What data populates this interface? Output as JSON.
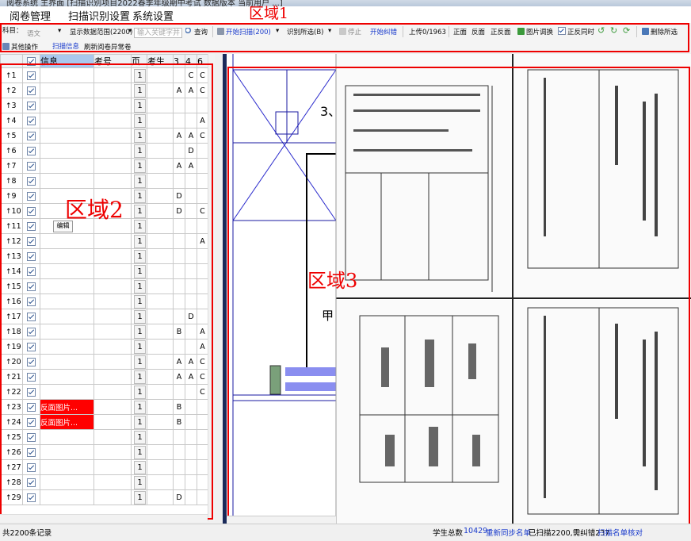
{
  "titlebar": {
    "text": "阅卷系统  主界面  [扫描识别项目2022春季年级期中考试 数据版本 当前用户 ...]"
  },
  "menu": [
    "阅卷管理",
    "扫描识别设置",
    "系统设置"
  ],
  "regions": {
    "area1": "区域1",
    "area2": "区域2",
    "area3": "区域3"
  },
  "toolbar": {
    "subject_label": "科目：",
    "subject_value": "语文",
    "range_label": "显示数据范围(2200)",
    "search_placeholder": "输入关键字并",
    "query_label": "查询",
    "start_scan_label": "开始扫描(200)",
    "recognize_label": "识别所选(B)",
    "stop_label": "停止",
    "start_correct_label": "开始纠错",
    "upload_label": "上传0/1963",
    "front_label": "正面",
    "back_label": "反面",
    "front_back_label": "正反面",
    "image_swap_label": "图片调换",
    "front_back_same_label": "正反同时",
    "delete_selected_label": "删除所选",
    "other_ops_label": "其他操作",
    "scan_info_label": "扫描信息",
    "refresh_label": "刷新阅卷异常卷"
  },
  "grid": {
    "headers": [
      "信息",
      "考号",
      "页",
      "考生",
      "3",
      "4",
      "6"
    ],
    "page_value": "1",
    "rows": [
      {
        "n": "1",
        "info": "",
        "c3": "",
        "c4": "C",
        "c6": "C"
      },
      {
        "n": "2",
        "info": "",
        "c3": "A",
        "c4": "A",
        "c6": "C"
      },
      {
        "n": "3",
        "info": "",
        "c3": "",
        "c4": "",
        "c6": ""
      },
      {
        "n": "4",
        "info": "",
        "c3": "",
        "c4": "",
        "c6": "A"
      },
      {
        "n": "5",
        "info": "",
        "c3": "A",
        "c4": "A",
        "c6": "C"
      },
      {
        "n": "6",
        "info": "",
        "c3": "",
        "c4": "D",
        "c6": ""
      },
      {
        "n": "7",
        "info": "",
        "c3": "A",
        "c4": "A",
        "c6": ""
      },
      {
        "n": "8",
        "info": "",
        "c3": "",
        "c4": "",
        "c6": ""
      },
      {
        "n": "9",
        "info": "",
        "c3": "D",
        "c4": "",
        "c6": ""
      },
      {
        "n": "10",
        "info": "",
        "c3": "D",
        "c4": "",
        "c6": "C"
      },
      {
        "n": "11",
        "info": "",
        "c3": "",
        "c4": "",
        "c6": ""
      },
      {
        "n": "12",
        "info": "",
        "c3": "",
        "c4": "",
        "c6": "A"
      },
      {
        "n": "13",
        "info": "",
        "c3": "",
        "c4": "",
        "c6": ""
      },
      {
        "n": "14",
        "info": "",
        "c3": "",
        "c4": "",
        "c6": ""
      },
      {
        "n": "15",
        "info": "",
        "c3": "",
        "c4": "",
        "c6": ""
      },
      {
        "n": "16",
        "info": "",
        "c3": "",
        "c4": "",
        "c6": ""
      },
      {
        "n": "17",
        "info": "",
        "c3": "",
        "c4": "D",
        "c6": ""
      },
      {
        "n": "18",
        "info": "",
        "c3": "B",
        "c4": "",
        "c6": "A"
      },
      {
        "n": "19",
        "info": "",
        "c3": "",
        "c4": "",
        "c6": "A"
      },
      {
        "n": "20",
        "info": "",
        "c3": "A",
        "c4": "A",
        "c6": "C"
      },
      {
        "n": "21",
        "info": "",
        "c3": "A",
        "c4": "A",
        "c6": "C"
      },
      {
        "n": "22",
        "info": "",
        "c3": "",
        "c4": "",
        "c6": "C"
      },
      {
        "n": "23",
        "info": "反面图片...",
        "c3": "B",
        "c4": "",
        "c6": ""
      },
      {
        "n": "24",
        "info": "反面图片...",
        "c3": "B",
        "c4": "",
        "c6": ""
      },
      {
        "n": "25",
        "info": "",
        "c3": "",
        "c4": "",
        "c6": ""
      },
      {
        "n": "26",
        "info": "",
        "c3": "",
        "c4": "",
        "c6": ""
      },
      {
        "n": "27",
        "info": "",
        "c3": "",
        "c4": "",
        "c6": ""
      },
      {
        "n": "28",
        "info": "",
        "c3": "",
        "c4": "",
        "c6": ""
      },
      {
        "n": "29",
        "info": "",
        "c3": "D",
        "c4": "",
        "c6": ""
      }
    ],
    "edit_popup": "编辑"
  },
  "image": {
    "text_3": "3、",
    "text_jia": "甲"
  },
  "status": {
    "total_records": "共2200条记录",
    "student_total_label": "学生总数",
    "student_total_value": "10429",
    "resync_label": "重新同步名单",
    "scanned_label": "已扫描2200,需纠错237",
    "scan_check_label": "扫描名单核对"
  },
  "colors": {
    "region_red": "#ee0000",
    "link_blue": "#1a3bcc",
    "error_red": "#ff0000"
  }
}
